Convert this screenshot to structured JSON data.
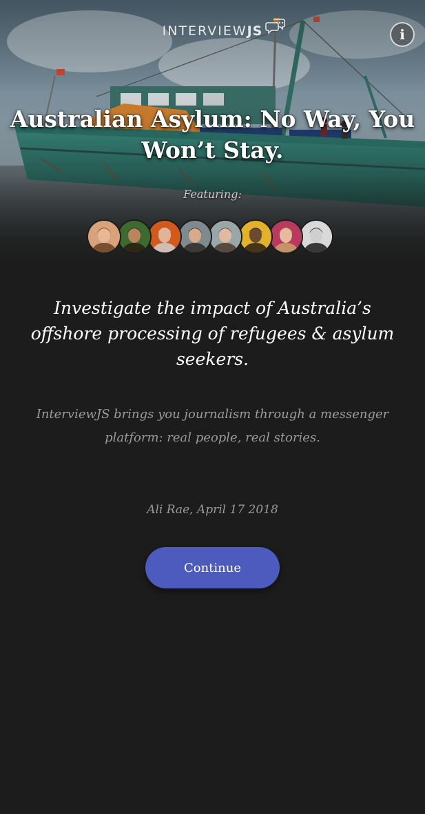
{
  "header": {
    "logo_text": "INTERVIEW",
    "logo_bold": "JS",
    "logo_icon": "chat-bubbles-icon",
    "info_label": "i",
    "info_icon": "info-icon"
  },
  "story": {
    "title": "Australian Asylum: No Way, You Won’t Stay.",
    "featuring_label": "Featuring:",
    "lead": "Investigate the impact of Australia’s offshore processing of refugees & asylum seekers.",
    "description": "InterviewJS brings you journalism through a messenger platform: real people, real stories.",
    "byline": "Ali Rae, April 17 2018"
  },
  "avatars": [
    {
      "name": "avatar-1",
      "bg": "#d8a27b",
      "skin": "#e8b896",
      "hair": "#6b3f22"
    },
    {
      "name": "avatar-2",
      "bg": "#3d6a2e",
      "skin": "#b98560",
      "hair": "#2a1c12"
    },
    {
      "name": "avatar-3",
      "bg": "#d35a1f",
      "skin": "#e2b497",
      "hair": "#cfcfcf"
    },
    {
      "name": "avatar-4",
      "bg": "#7f8a8e",
      "skin": "#d8a98b",
      "hair": "#2f2a26"
    },
    {
      "name": "avatar-5",
      "bg": "#9aa7a8",
      "skin": "#dfb9a0",
      "hair": "#4a3a2c"
    },
    {
      "name": "avatar-6",
      "bg": "#e3b22b",
      "skin": "#6b4a32",
      "hair": "#2b1d14"
    },
    {
      "name": "avatar-7",
      "bg": "#b83a5e",
      "skin": "#e4bca0",
      "hair": "#c9a16b"
    },
    {
      "name": "avatar-8",
      "bg": "#d9d9d9",
      "skin": "#cfcfcf",
      "hair": "#1b1b1b"
    }
  ],
  "actions": {
    "continue_label": "Continue"
  },
  "colors": {
    "background": "#1c1c1c",
    "accent": "#4c5bbd",
    "muted_text": "#9a9a9a"
  }
}
